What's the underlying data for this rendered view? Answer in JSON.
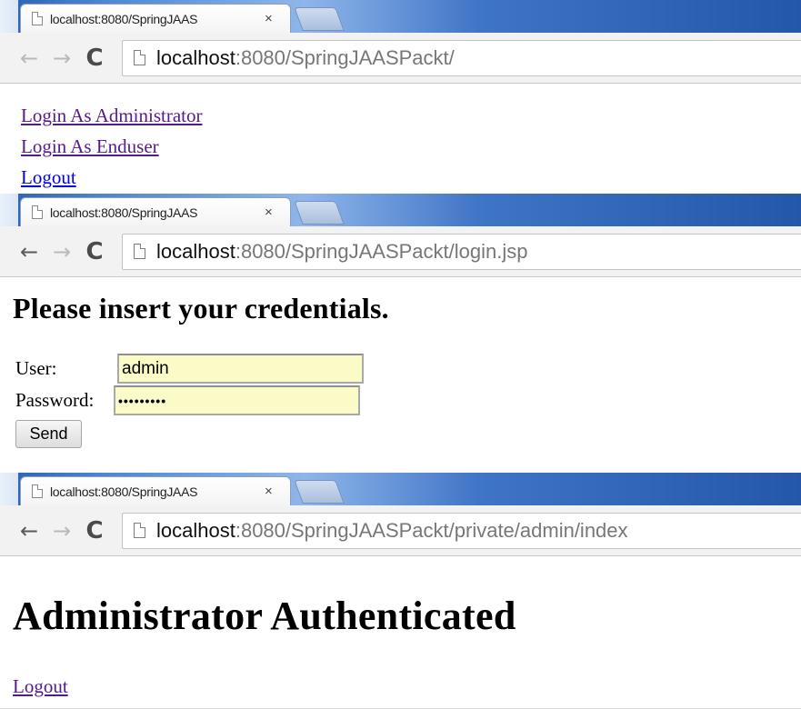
{
  "windows": [
    {
      "tab_title": "localhost:8080/SpringJAAS",
      "tab_close": "×",
      "url_host": "localhost",
      "url_rest": ":8080/SpringJAASPackt/",
      "back_enabled": false,
      "links": [
        {
          "label": "Login As Administrator"
        },
        {
          "label": "Login As Enduser"
        },
        {
          "label": "Logout"
        }
      ]
    },
    {
      "tab_title": "localhost:8080/SpringJAAS",
      "tab_close": "×",
      "url_host": "localhost",
      "url_rest": ":8080/SpringJAASPackt/login.jsp",
      "back_enabled": true,
      "heading": "Please insert your credentials.",
      "user_label": "User:",
      "user_value": "admin",
      "password_label": "Password:",
      "password_value": "•••••••••",
      "send_label": "Send"
    },
    {
      "tab_title": "localhost:8080/SpringJAAS",
      "tab_close": "×",
      "url_host": "localhost",
      "url_rest": ":8080/SpringJAASPackt/private/admin/index",
      "back_enabled": true,
      "heading": "Administrator Authenticated",
      "logout_label": "Logout"
    }
  ],
  "icons": {
    "back": "←",
    "forward": "→",
    "reload": "C"
  }
}
